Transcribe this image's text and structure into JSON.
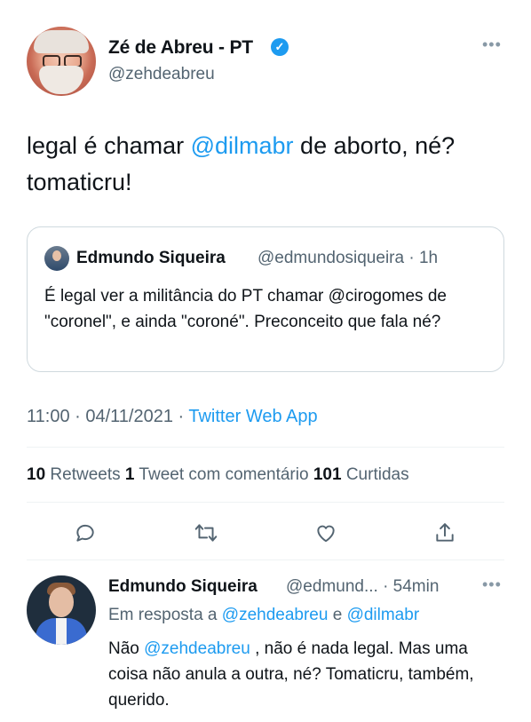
{
  "tweet": {
    "author_name": "Zé de Abreu - PT",
    "handle": "@zehdeabreu",
    "text_before": "legal é chamar ",
    "mention": "@dilmabr",
    "text_after": " de aborto, né? tomaticru!",
    "more_label": "•••"
  },
  "quote": {
    "author_name": "Edmundo Siqueira",
    "meta": "@edmundosiqueira · 1h",
    "text": "É legal ver a militância do PT chamar @cirogomes de \"coronel\", e ainda \"coroné\". Preconceito que fala né?"
  },
  "meta": {
    "time": "11:00 · 04/11/2021 · ",
    "source": "Twitter Web App"
  },
  "stats": {
    "retweets_count": "10",
    "retweets_label": " Retweets ",
    "quotes_count": "1",
    "quotes_label": " Tweet com comentário ",
    "likes_count": "101",
    "likes_label": " Curtidas"
  },
  "actions": [
    "reply-icon",
    "retweet-icon",
    "like-icon",
    "share-icon"
  ],
  "reply": {
    "author_name": "Edmundo Siqueira",
    "meta": "@edmund... · 54min",
    "replying_prefix": "Em resposta a ",
    "replying_to_1": "@zehdeabreu",
    "replying_conj": " e ",
    "replying_to_2": "@dilmabr",
    "text_before": "Não ",
    "mention": "@zehdeabreu",
    "text_after": " , não é nada legal. Mas uma coisa não anula a outra, né? Tomaticru, também, querido.",
    "more_label": "•••"
  },
  "colors": {
    "accent": "#1d9bf0",
    "muted": "#536471",
    "border": "#cfd9de"
  }
}
